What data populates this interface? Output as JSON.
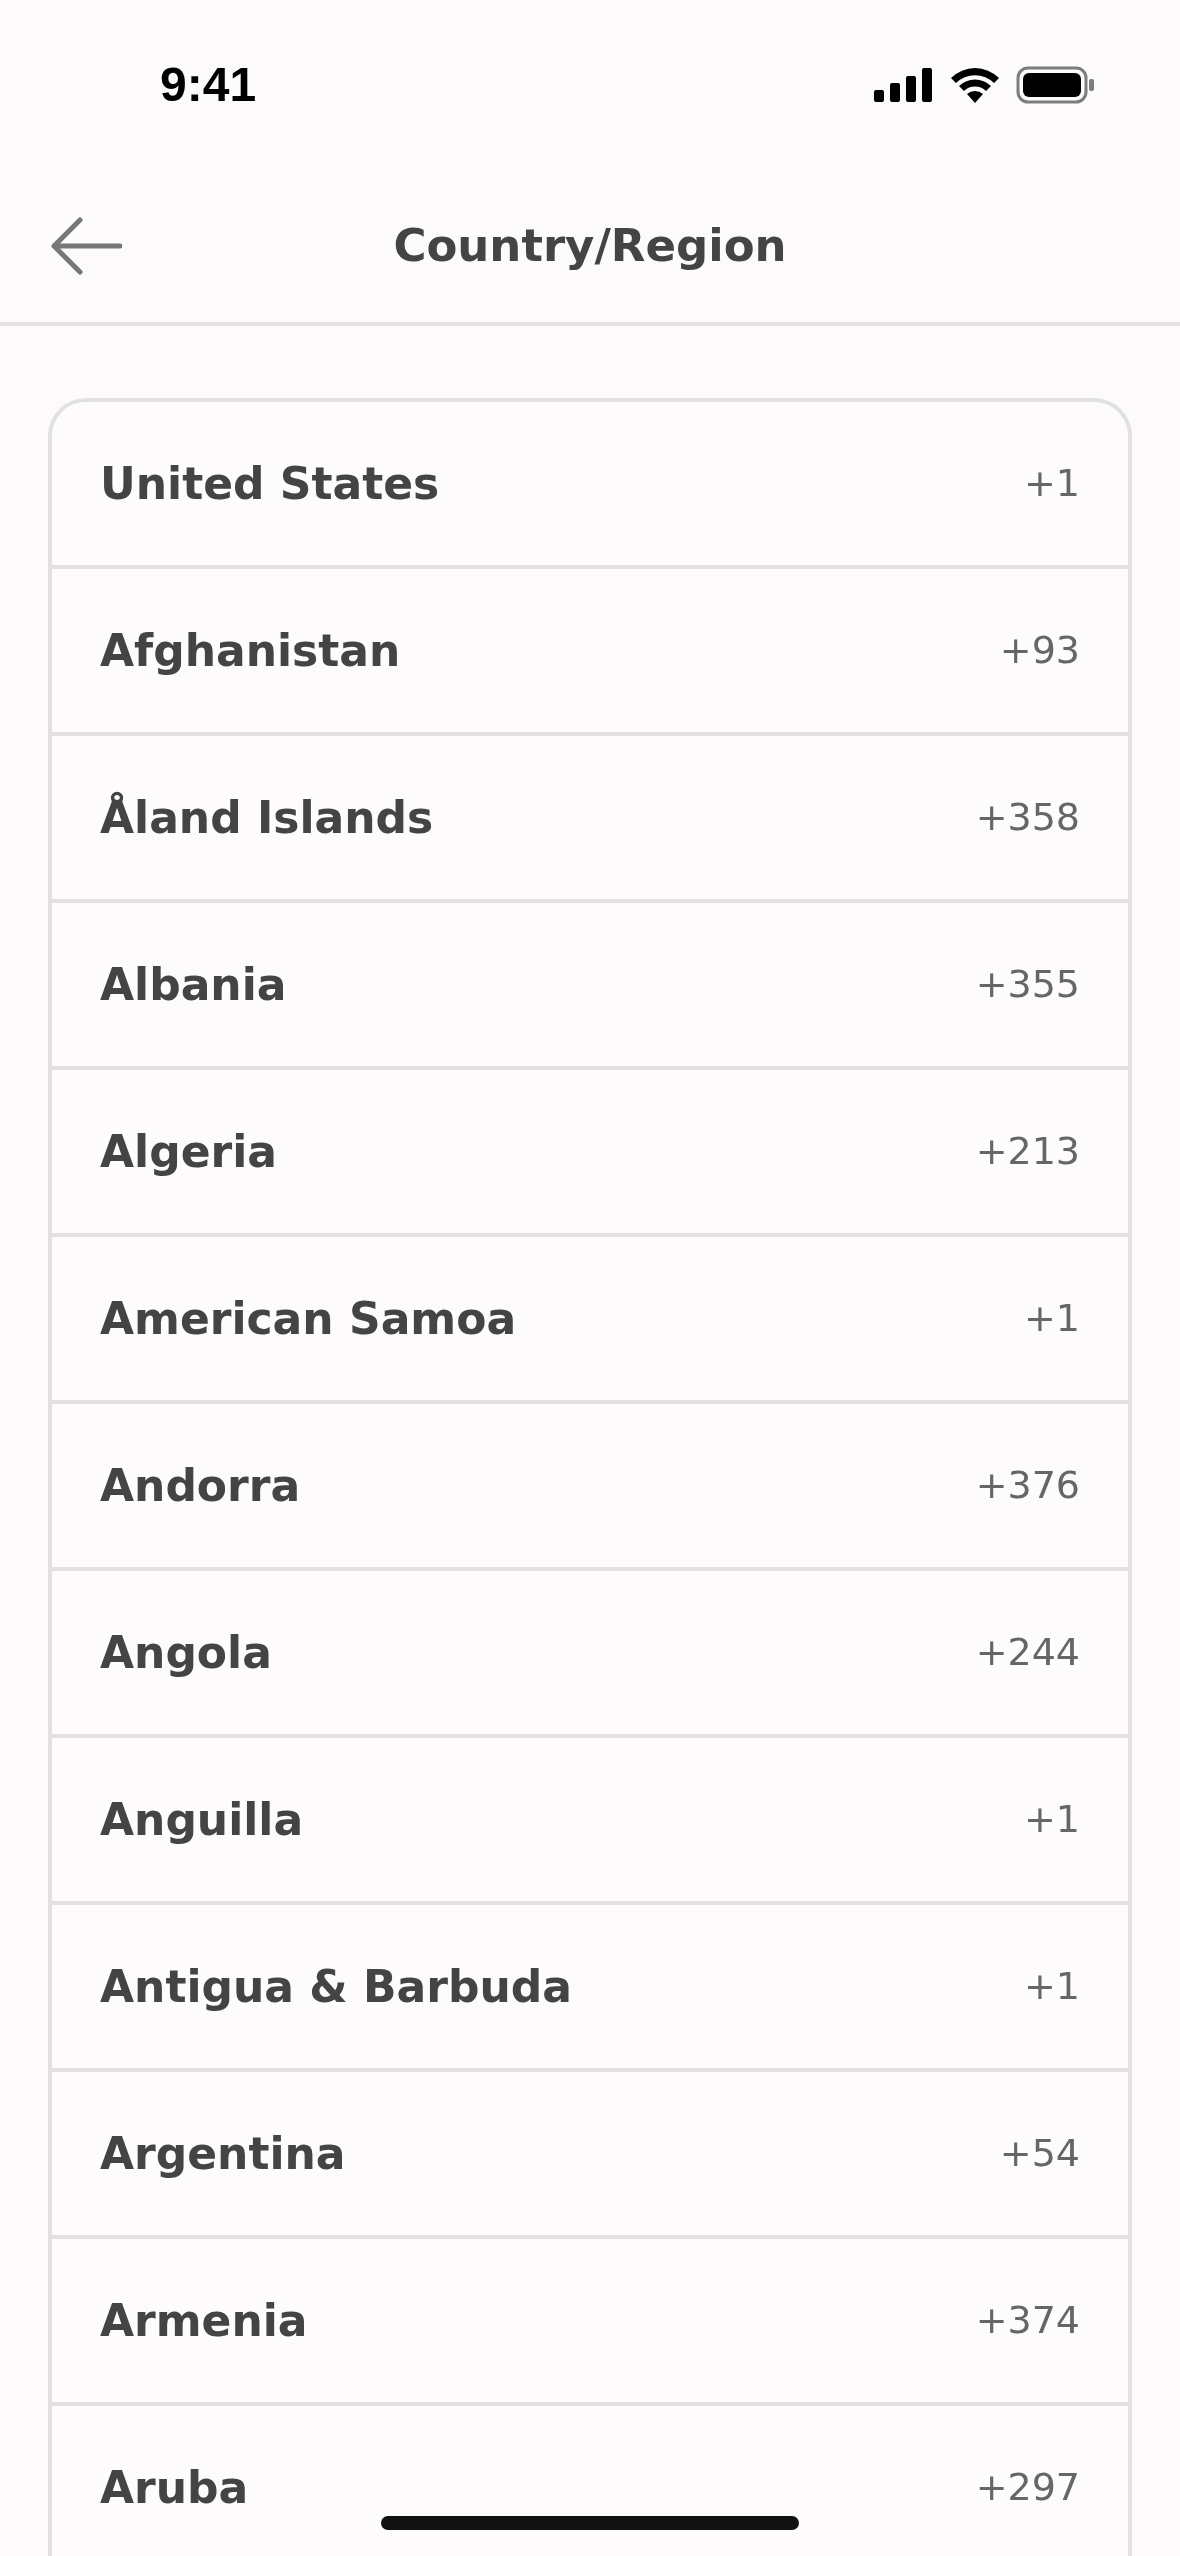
{
  "status_bar": {
    "time": "9:41"
  },
  "header": {
    "title": "Country/Region"
  },
  "countries": [
    {
      "name": "United States",
      "code": "+1"
    },
    {
      "name": "Afghanistan",
      "code": "+93"
    },
    {
      "name": "Åland Islands",
      "code": "+358"
    },
    {
      "name": "Albania",
      "code": "+355"
    },
    {
      "name": "Algeria",
      "code": "+213"
    },
    {
      "name": "American Samoa",
      "code": "+1"
    },
    {
      "name": "Andorra",
      "code": "+376"
    },
    {
      "name": "Angola",
      "code": "+244"
    },
    {
      "name": "Anguilla",
      "code": "+1"
    },
    {
      "name": "Antigua & Barbuda",
      "code": "+1"
    },
    {
      "name": "Argentina",
      "code": "+54"
    },
    {
      "name": "Armenia",
      "code": "+374"
    },
    {
      "name": "Aruba",
      "code": "+297"
    }
  ]
}
